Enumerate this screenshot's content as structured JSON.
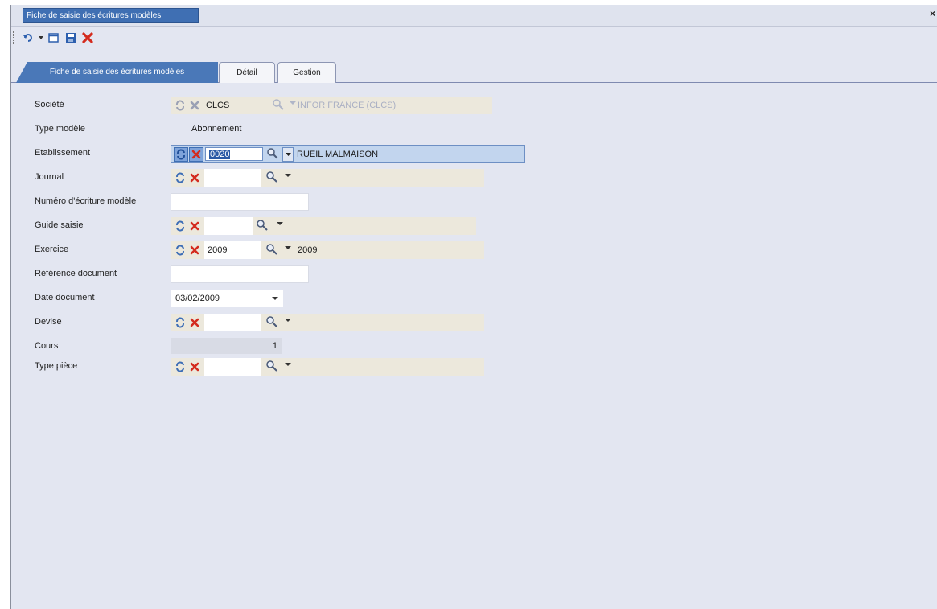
{
  "window": {
    "doc_tab_title": "Fiche de saisie des écritures modèles",
    "close_glyph": "×"
  },
  "toolbar": {
    "icons": [
      "undo-icon",
      "dropdown-arrow-icon",
      "new-document-icon",
      "save-icon",
      "delete-icon"
    ]
  },
  "tabs": [
    {
      "label": "Fiche de saisie des écritures modèles",
      "active": true
    },
    {
      "label": "Détail",
      "active": false
    },
    {
      "label": "Gestion",
      "active": false
    }
  ],
  "form": {
    "societe": {
      "label": "Société",
      "code": "CLCS",
      "libelle": "INFOR FRANCE (CLCS)"
    },
    "type_modele": {
      "label": "Type modèle",
      "value": "Abonnement"
    },
    "etablissement": {
      "label": "Etablissement",
      "code": "0020",
      "libelle": "RUEIL MALMAISON"
    },
    "journal": {
      "label": "Journal",
      "code": "",
      "libelle": ""
    },
    "numero_ecriture": {
      "label": "Numéro d'écriture modèle",
      "value": ""
    },
    "guide_saisie": {
      "label": "Guide saisie",
      "code": "",
      "libelle": ""
    },
    "exercice": {
      "label": "Exercice",
      "code": "2009",
      "libelle": "2009"
    },
    "reference_document": {
      "label": "Référence document",
      "value": ""
    },
    "date_document": {
      "label": "Date document",
      "value": "03/02/2009"
    },
    "devise": {
      "label": "Devise",
      "code": "",
      "libelle": ""
    },
    "cours": {
      "label": "Cours",
      "value": "1"
    },
    "type_piece": {
      "label": "Type pièce",
      "code": "",
      "libelle": ""
    }
  },
  "colors": {
    "accent_tab": "#4a78b8",
    "highlight_field": "#c2d5ee",
    "field_bg": "#ece8dc",
    "delete_red": "#d42b1e"
  }
}
